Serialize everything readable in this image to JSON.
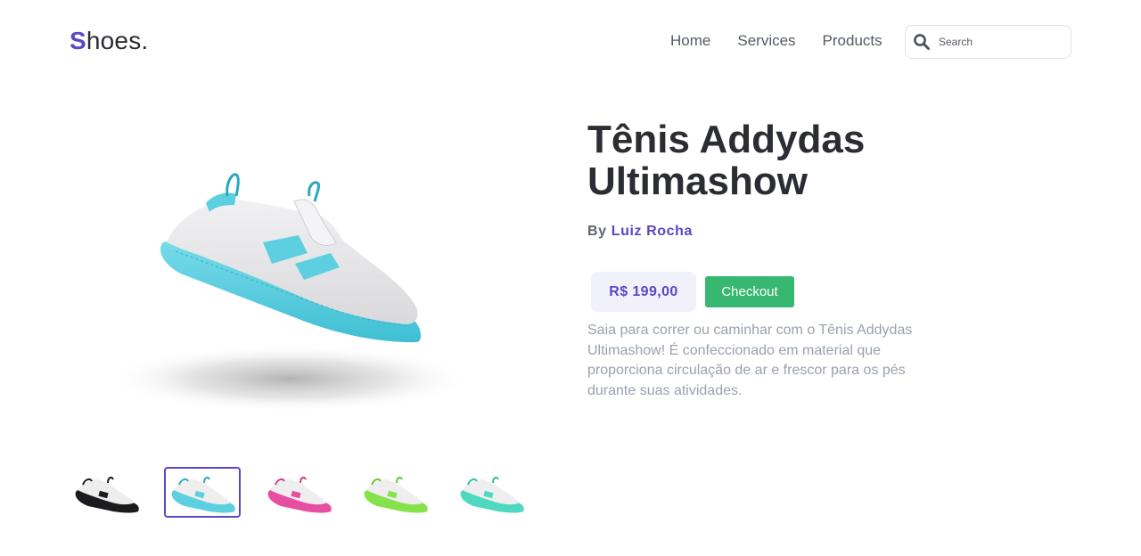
{
  "header": {
    "logo_first": "S",
    "logo_rest": "hoes.",
    "nav": [
      "Home",
      "Services",
      "Products"
    ],
    "search": {
      "placeholder": "Search",
      "icon": "search-icon"
    }
  },
  "product": {
    "title": "Tênis Addydas Ultimashow",
    "by_label": "By",
    "author": "Luiz Rocha",
    "price": "R$ 199,00",
    "checkout_label": "Checkout",
    "description": "Saia para correr ou caminhar com o Tênis Addydas Ultimashow! É confeccionado em material que proporciona circulação de ar e frescor para os pés durante suas atividades."
  },
  "gallery": {
    "selected_index": 1,
    "thumbnails": [
      {
        "variant": "black",
        "color": "#1c1c1f"
      },
      {
        "variant": "cyan",
        "color": "#5ccfe0"
      },
      {
        "variant": "pink",
        "color": "#e64fa1"
      },
      {
        "variant": "green",
        "color": "#86e24a"
      },
      {
        "variant": "teal",
        "color": "#4fd8c0"
      }
    ]
  },
  "colors": {
    "accent": "#5b47c4",
    "checkout": "#37b770",
    "price_bg": "#f1f1fb",
    "shoe_sole": "#5ccfe0",
    "shoe_upper": "#e6e6e8"
  }
}
